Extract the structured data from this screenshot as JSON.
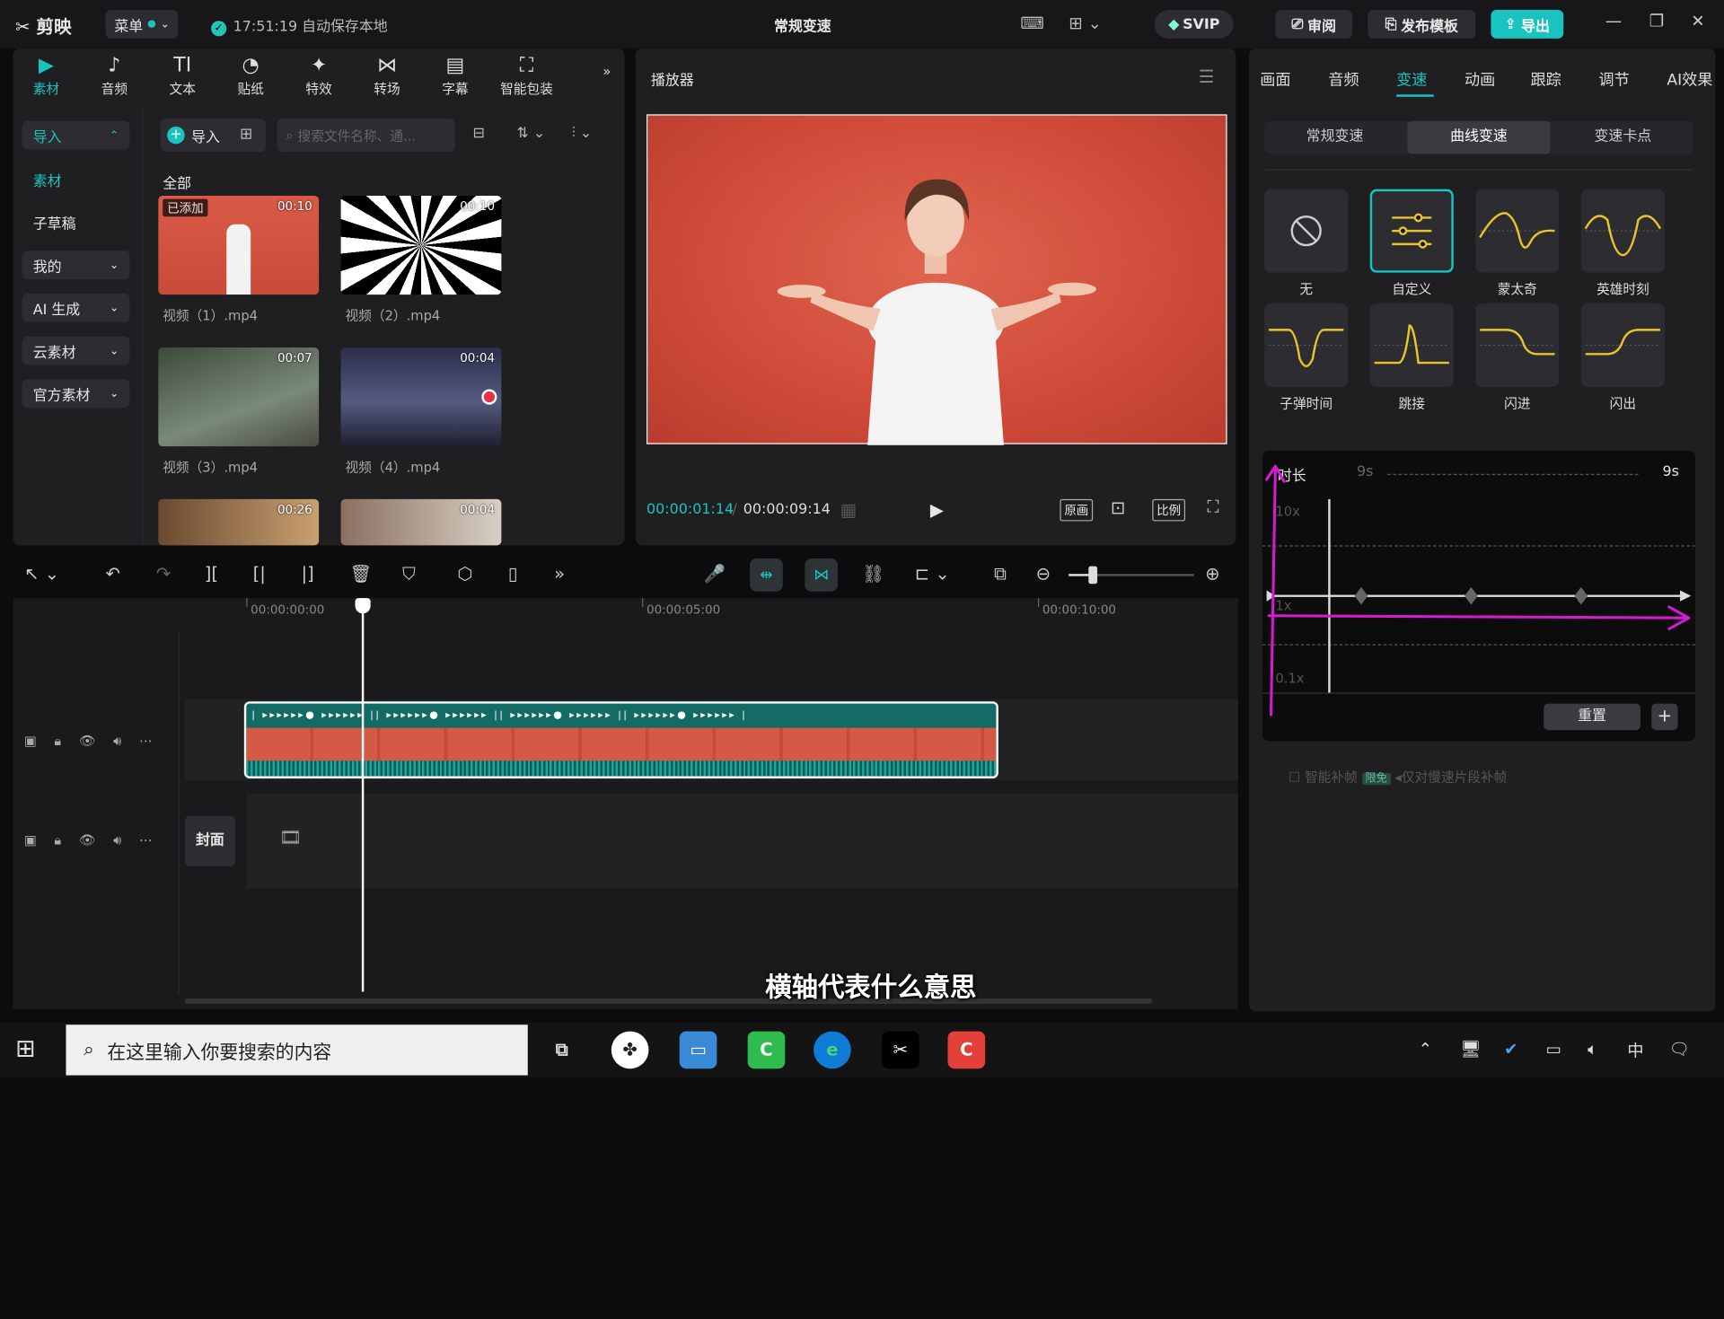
{
  "titlebar": {
    "logo": "剪映",
    "menu": "菜单",
    "save_time": "17:51:19",
    "save_text": "自动保存本地",
    "title": "常规变速",
    "svip": "SVIP",
    "review": "审阅",
    "publish": "发布模板",
    "export": "导出"
  },
  "media": {
    "tabs": [
      {
        "icon": "▶",
        "label": "素材"
      },
      {
        "icon": "♪",
        "label": "音频"
      },
      {
        "icon": "TI",
        "label": "文本"
      },
      {
        "icon": "◔",
        "label": "贴纸"
      },
      {
        "icon": "✦",
        "label": "特效"
      },
      {
        "icon": "⋈",
        "label": "转场"
      },
      {
        "icon": "▤",
        "label": "字幕"
      },
      {
        "icon": "⛶",
        "label": "智能包装"
      }
    ],
    "sidebar": [
      "导入",
      "素材",
      "子草稿",
      "我的",
      "AI 生成",
      "云素材",
      "官方素材"
    ],
    "import_btn": "导入",
    "search_placeholder": "搜索文件名称、通...",
    "all": "全部",
    "added": "已添加",
    "items": [
      {
        "name": "视频（1）.mp4",
        "dur": "00:10"
      },
      {
        "name": "视频（2）.mp4",
        "dur": "00:10"
      },
      {
        "name": "视频（3）.mp4",
        "dur": "00:07"
      },
      {
        "name": "视频（4）.mp4",
        "dur": "00:04"
      },
      {
        "name": "",
        "dur": "00:26"
      },
      {
        "name": "",
        "dur": "00:04"
      }
    ]
  },
  "player": {
    "title": "播放器",
    "current": "00:00:01:14",
    "total": "00:00:09:14",
    "btn_original": "原画",
    "btn_ratio": "比例"
  },
  "props": {
    "tabs": [
      "画面",
      "音频",
      "变速",
      "动画",
      "跟踪",
      "调节",
      "AI效果"
    ],
    "speed_tabs": [
      "常规变速",
      "曲线变速",
      "变速卡点"
    ],
    "presets": [
      "无",
      "自定义",
      "蒙太奇",
      "英雄时刻",
      "子弹时间",
      "跳接",
      "闪进",
      "闪出"
    ],
    "graph": {
      "duration_label": "时长",
      "dur_left": "9s",
      "dur_right": "9s",
      "y_top": "10x",
      "y_mid": "1x",
      "y_bot": "0.1x"
    },
    "reset": "重置",
    "add": "+",
    "smart": "智能补帧",
    "smart_badge": "限免",
    "smart_note": "仅对慢速片段补帧"
  },
  "timeline": {
    "ruler": [
      "00:00:00:00",
      "00:00:05:00",
      "00:00:10:00"
    ],
    "cover": "封面",
    "caption": "横轴代表什么意思"
  },
  "taskbar": {
    "search": "在这里输入你要搜索的内容",
    "ime": "中"
  }
}
